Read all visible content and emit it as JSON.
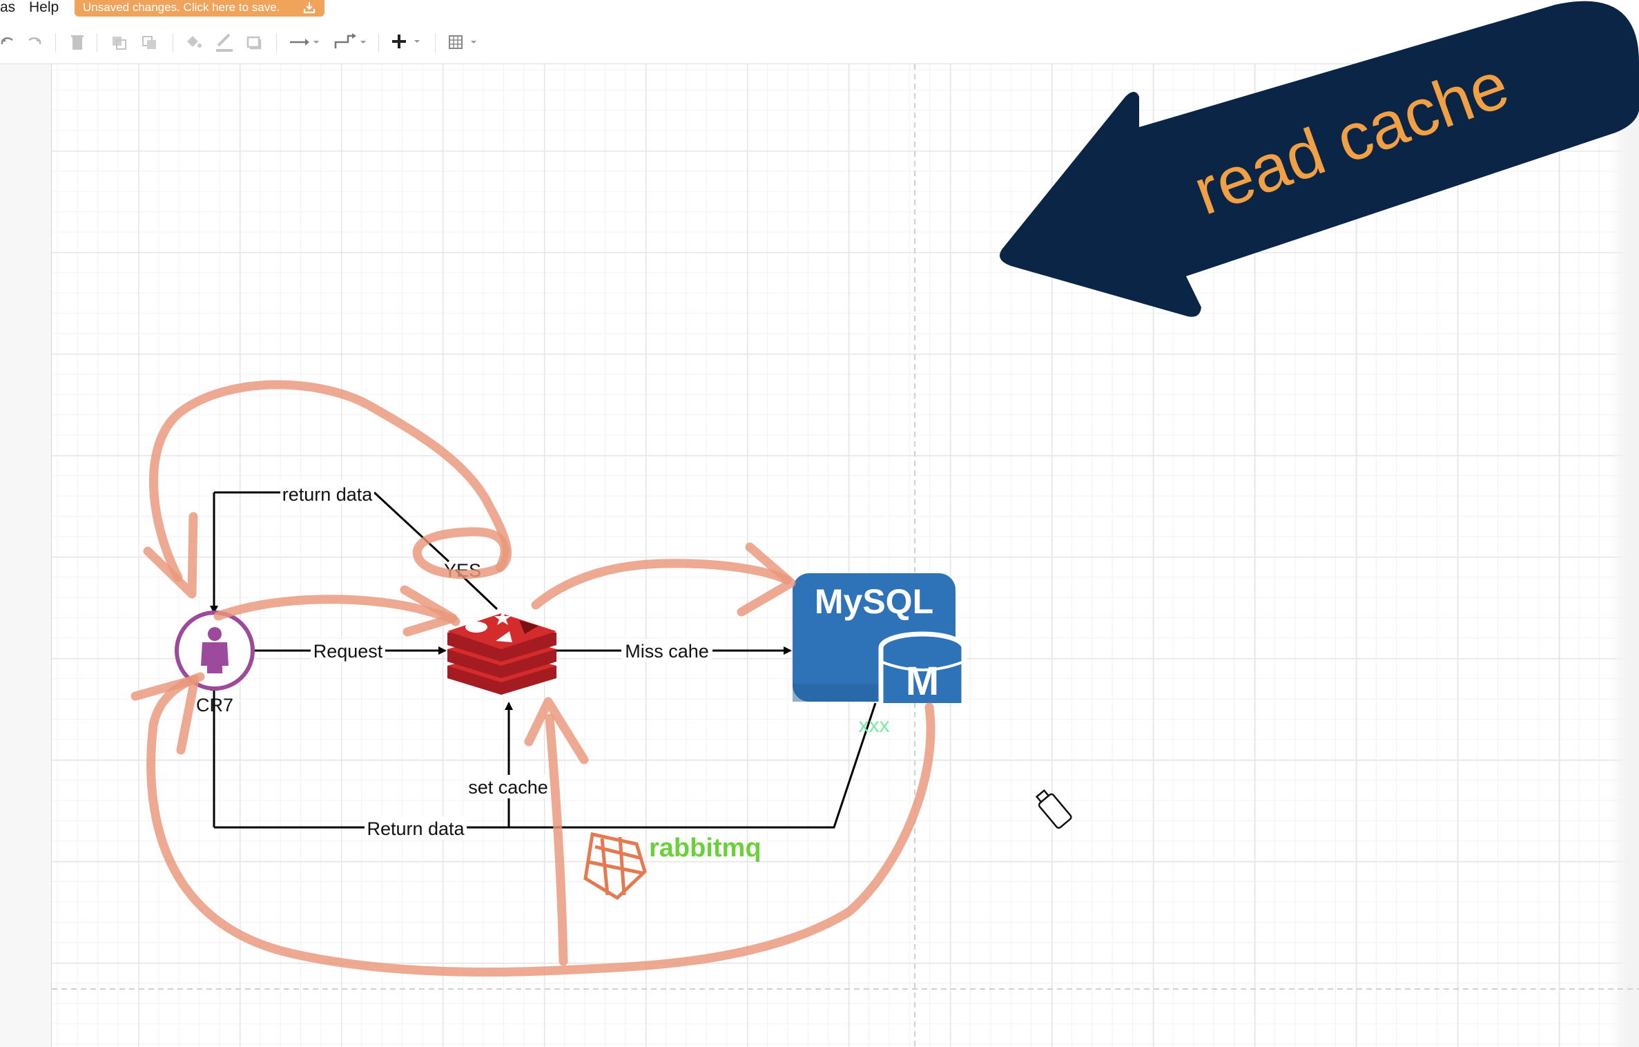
{
  "menubar": {
    "items": [
      {
        "label": "as"
      },
      {
        "label": "Help"
      }
    ],
    "unsaved_notice": "Unsaved changes. Click here to save."
  },
  "toolbar": {
    "icons": [
      "undo-icon",
      "redo-icon",
      "delete-icon",
      "to-front-icon",
      "to-back-icon",
      "fill-color-icon",
      "line-color-icon",
      "shadow-icon",
      "connection-icon",
      "waypoints-icon",
      "insert-icon",
      "table-icon"
    ]
  },
  "diagram": {
    "user_label": "CR7",
    "edge_request": "Request",
    "edge_return_top": "return data",
    "edge_yes": "YES",
    "edge_miss": "Miss cahe",
    "edge_set_cache": "set cache",
    "edge_return_bottom": "Return data",
    "mysql_title": "MySQL",
    "mysql_badge": "M",
    "mysql_caption": "xxx",
    "rabbitmq_label": "rabbitmq",
    "banner_text": "read cache"
  },
  "colors": {
    "annotation_stroke": "#e9967a",
    "banner_fill": "#0b2546",
    "banner_text": "#f2a044",
    "redis_red": "#c9202a",
    "mysql_blue": "#2e73b8",
    "user_purple": "#9b4a9c",
    "rabbitmq_green": "#6bd13a",
    "caption_green": "#77e8a6",
    "unsaved_orange": "#f0a35a"
  }
}
